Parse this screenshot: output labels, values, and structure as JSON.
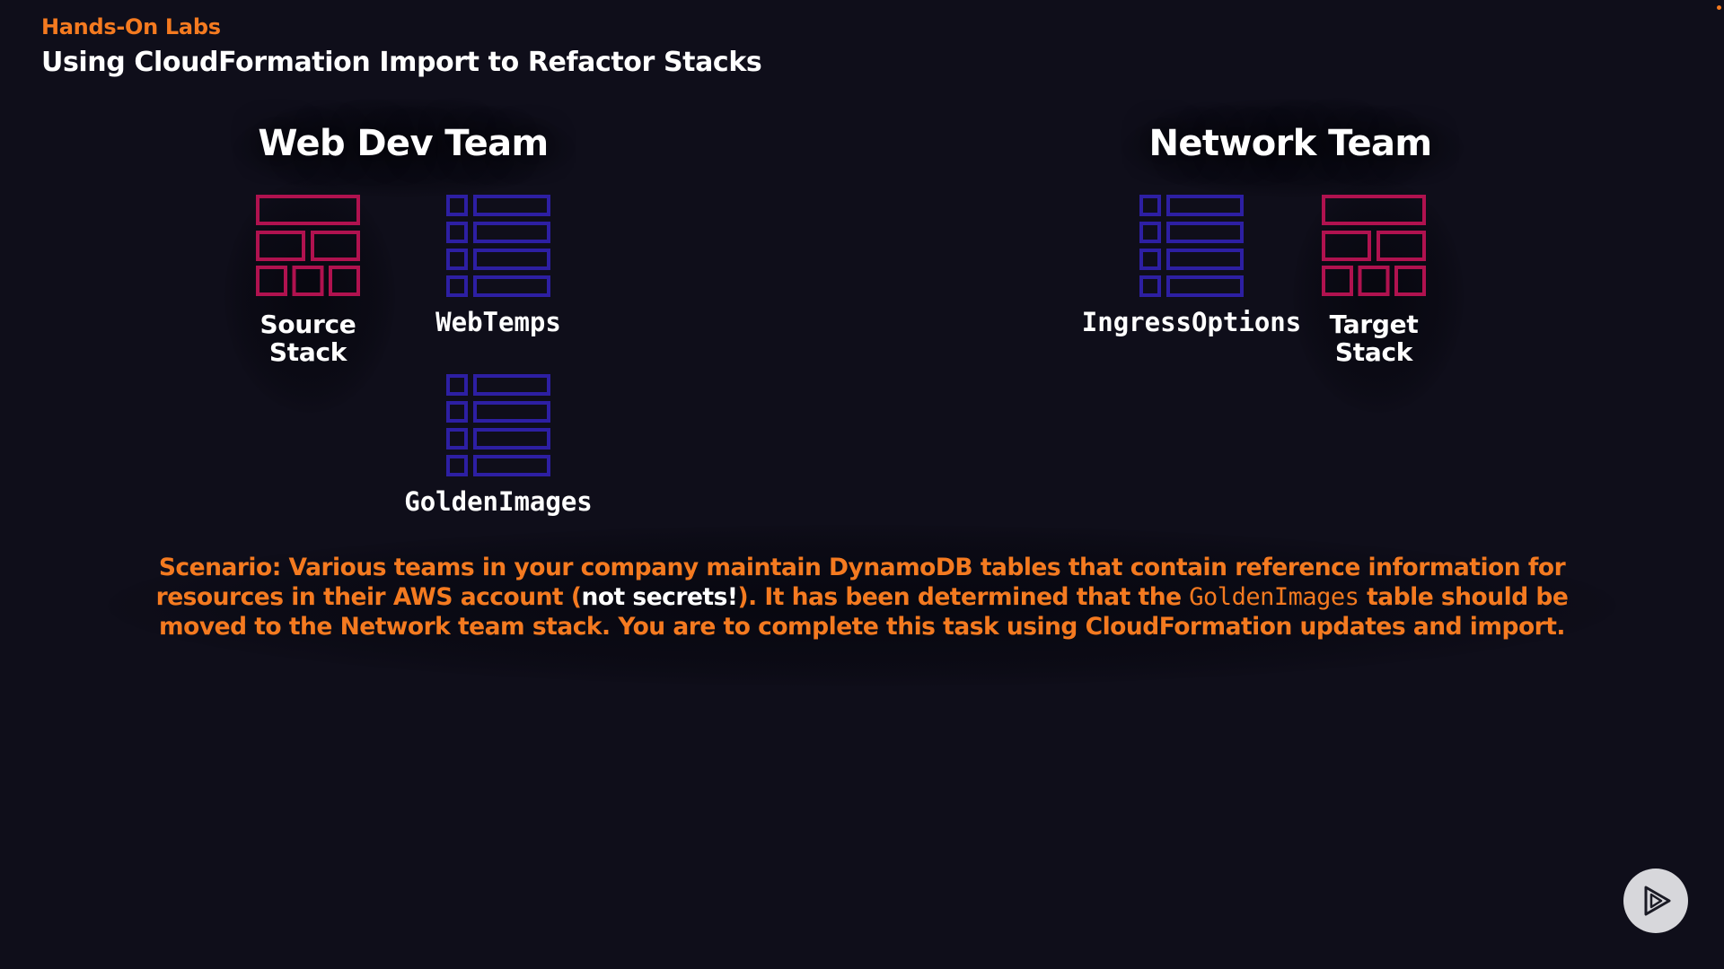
{
  "header": {
    "kicker": "Hands-On Labs",
    "title": "Using CloudFormation Import to Refactor Stacks"
  },
  "teams": {
    "web_dev": {
      "title": "Web Dev Team",
      "stack_label_line1": "Source",
      "stack_label_line2": "Stack",
      "tables": [
        "WebTemps",
        "GoldenImages"
      ]
    },
    "network": {
      "title": "Network Team",
      "stack_label_line1": "Target",
      "stack_label_line2": "Stack",
      "tables": [
        "IngressOptions"
      ]
    }
  },
  "icons": {
    "stack_icon": "stack-grid-icon",
    "table_icon": "dynamodb-table-icon"
  },
  "scenario": {
    "part1": "Scenario: Various teams in your company maintain DynamoDB tables that contain reference information for resources in their AWS account (",
    "highlight": "not secrets!",
    "part2": "). It has been determined that the ",
    "code": "GoldenImages",
    "part3": " table should be moved to the Network team stack. You are to complete this task using CloudFormation updates and import."
  },
  "colors": {
    "background": "#0f0e1a",
    "accent_orange": "#f47a20",
    "stack_magenta": "#b0124f",
    "table_indigo": "#2d1fa3",
    "text_white": "#ffffff"
  },
  "controls": {
    "play_icon": "play-icon"
  }
}
